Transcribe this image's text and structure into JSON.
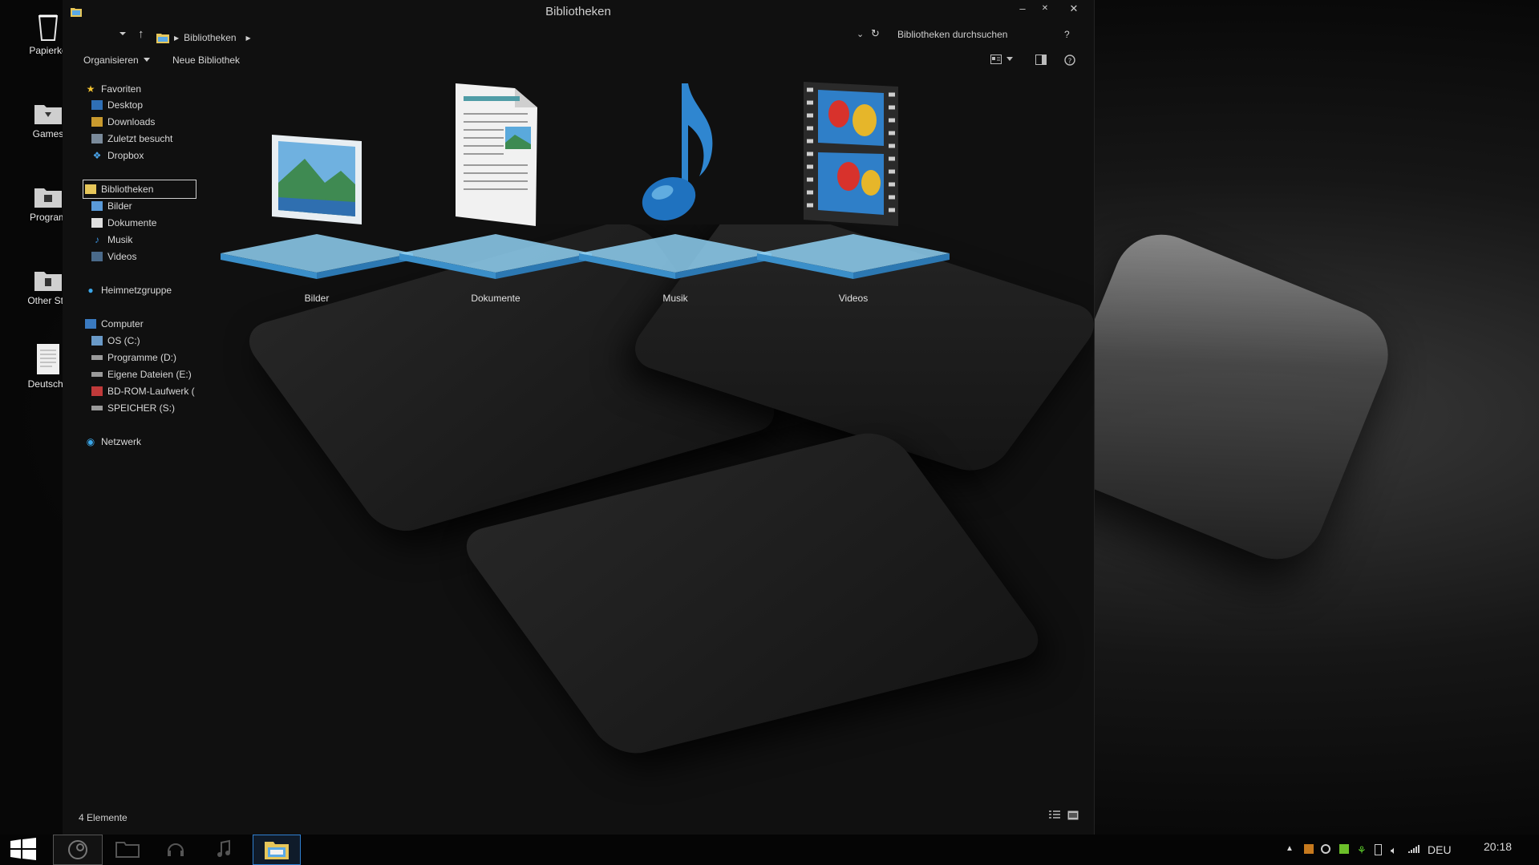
{
  "desktop": {
    "icons": [
      {
        "label": "Papierko",
        "icon": "recycle-bin-icon"
      },
      {
        "label": "Games",
        "icon": "folder-icon"
      },
      {
        "label": "Program",
        "icon": "folder-icon"
      },
      {
        "label": "Other Stu",
        "icon": "folder-icon"
      },
      {
        "label": "Deutsch.t",
        "icon": "text-file-icon"
      }
    ]
  },
  "window": {
    "title": "Bibliotheken",
    "breadcrumb": "Bibliotheken",
    "search_placeholder": "Bibliotheken durchsuchen",
    "help_label": "?",
    "controls": {
      "minimize": "–",
      "maximize": "✕",
      "close": "✕"
    }
  },
  "commands": {
    "organize": "Organisieren",
    "new_library": "Neue Bibliothek"
  },
  "nav": {
    "favorites": "Favoriten",
    "favorite_items": [
      "Desktop",
      "Downloads",
      "Zuletzt besucht",
      "Dropbox"
    ],
    "libraries": "Bibliotheken",
    "library_items": [
      "Bilder",
      "Dokumente",
      "Musik",
      "Videos"
    ],
    "homegroup": "Heimnetzgruppe",
    "computer": "Computer",
    "drives": [
      "OS (C:)",
      "Programme (D:)",
      "Eigene Dateien (E:)",
      "BD-ROM-Laufwerk (",
      "SPEICHER (S:)"
    ],
    "network": "Netzwerk"
  },
  "libraries": [
    {
      "label": "Bilder",
      "icon": "pictures-library-icon"
    },
    {
      "label": "Dokumente",
      "icon": "documents-library-icon"
    },
    {
      "label": "Musik",
      "icon": "music-library-icon"
    },
    {
      "label": "Videos",
      "icon": "videos-library-icon"
    }
  ],
  "status": {
    "count": "4 Elemente"
  },
  "taskbar": {
    "language": "DEU",
    "clock": "20:18"
  },
  "colors": {
    "accent": "#3a8fd8",
    "pedestal": "#7cc4ee",
    "window_bg": "#101010"
  }
}
